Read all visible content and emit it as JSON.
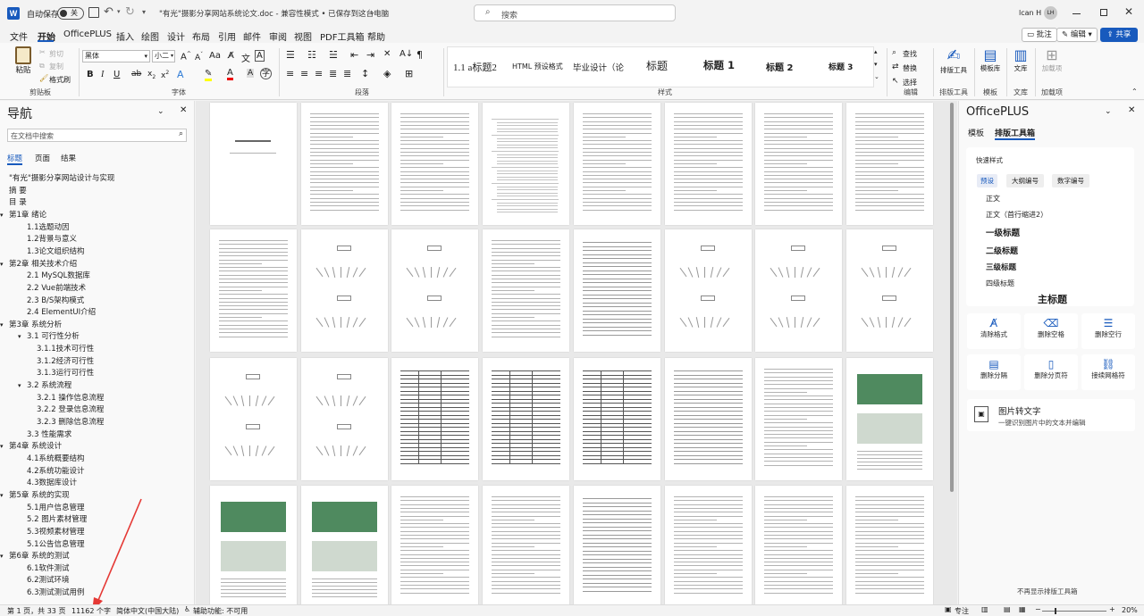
{
  "titlebar": {
    "autosave_label": "自动保存",
    "autosave_state": "关",
    "doc_title": "\"有光\"摄影分享网站系统论文.doc  -  兼容性模式  •  已保存到这台电脑",
    "search_placeholder": "搜索",
    "user_name": "lcan H",
    "user_initials": "LH"
  },
  "menubar": {
    "items": [
      "文件",
      "开始",
      "OfficePLUS",
      "插入",
      "绘图",
      "设计",
      "布局",
      "引用",
      "邮件",
      "审阅",
      "视图",
      "PDF工具箱",
      "帮助"
    ],
    "active": "开始",
    "comment_btn": "批注",
    "edit_btn": "编辑",
    "share_btn": "共享"
  },
  "ribbon": {
    "clipboard": {
      "paste": "粘贴",
      "cut": "剪切",
      "copy": "复制",
      "format_painter": "格式刷",
      "label": "剪贴板"
    },
    "font": {
      "name": "黑体",
      "size": "小二",
      "label": "字体"
    },
    "paragraph": {
      "label": "段落"
    },
    "styles": {
      "items": [
        "1.1 a标题2",
        "HTML 预设格式",
        "毕业设计（论",
        "标题",
        "标题 1",
        "标题 2",
        "标题 3"
      ],
      "label": "样式"
    },
    "editing": {
      "find": "查找",
      "replace": "替换",
      "select": "选择",
      "label": "编辑"
    },
    "layout_tool": {
      "btn": "排版工具",
      "label": "排版工具"
    },
    "template": {
      "btn": "模板库",
      "label": "模板"
    },
    "library": {
      "btn": "文库",
      "label": "文库"
    },
    "addins": {
      "btn": "加载项",
      "label": "加载项"
    }
  },
  "navpane": {
    "title": "导航",
    "search_placeholder": "在文档中搜索",
    "tabs": [
      "标题",
      "页面",
      "结果"
    ],
    "items": [
      {
        "text": "\"有光\"摄影分享网站设计与实现",
        "level": 0,
        "toggle": ""
      },
      {
        "text": "摘  要",
        "level": 0,
        "toggle": ""
      },
      {
        "text": "目  录",
        "level": 0,
        "toggle": ""
      },
      {
        "text": "第1章 绪论",
        "level": 0,
        "toggle": "▾"
      },
      {
        "text": "1.1选题动因",
        "level": 1,
        "toggle": ""
      },
      {
        "text": "1.2背景与意义",
        "level": 1,
        "toggle": ""
      },
      {
        "text": "1.3论文组织结构",
        "level": 1,
        "toggle": ""
      },
      {
        "text": "第2章 相关技术介绍",
        "level": 0,
        "toggle": "▾"
      },
      {
        "text": "2.1 MySQL数据库",
        "level": 1,
        "toggle": ""
      },
      {
        "text": "2.2 Vue前端技术",
        "level": 1,
        "toggle": ""
      },
      {
        "text": "2.3 B/S架构模式",
        "level": 1,
        "toggle": ""
      },
      {
        "text": "2.4 ElementUI介绍",
        "level": 1,
        "toggle": ""
      },
      {
        "text": "第3章 系统分析",
        "level": 0,
        "toggle": "▾"
      },
      {
        "text": "3.1 可行性分析",
        "level": 1,
        "toggle": "▾"
      },
      {
        "text": "3.1.1技术可行性",
        "level": 2,
        "toggle": ""
      },
      {
        "text": "3.1.2经济可行性",
        "level": 2,
        "toggle": ""
      },
      {
        "text": "3.1.3运行可行性",
        "level": 2,
        "toggle": ""
      },
      {
        "text": "3.2 系统流程",
        "level": 1,
        "toggle": "▾"
      },
      {
        "text": "3.2.1 操作信息流程",
        "level": 2,
        "toggle": ""
      },
      {
        "text": "3.2.2 登录信息流程",
        "level": 2,
        "toggle": ""
      },
      {
        "text": "3.2.3 删除信息流程",
        "level": 2,
        "toggle": ""
      },
      {
        "text": "3.3 性能需求",
        "level": 1,
        "toggle": ""
      },
      {
        "text": "第4章 系统设计",
        "level": 0,
        "toggle": "▾"
      },
      {
        "text": "4.1系统概要结构",
        "level": 1,
        "toggle": ""
      },
      {
        "text": "4.2系统功能设计",
        "level": 1,
        "toggle": ""
      },
      {
        "text": "4.3数据库设计",
        "level": 1,
        "toggle": ""
      },
      {
        "text": "第5章 系统的实现",
        "level": 0,
        "toggle": "▾"
      },
      {
        "text": "5.1用户信息管理",
        "level": 1,
        "toggle": ""
      },
      {
        "text": "5.2 图片素材管理",
        "level": 1,
        "toggle": ""
      },
      {
        "text": "5.3视频素材管理",
        "level": 1,
        "toggle": ""
      },
      {
        "text": "5.1公告信息管理",
        "level": 1,
        "toggle": ""
      },
      {
        "text": "第6章 系统的测试",
        "level": 0,
        "toggle": "▾"
      },
      {
        "text": "6.1软件测试",
        "level": 1,
        "toggle": ""
      },
      {
        "text": "6.2测试环境",
        "level": 1,
        "toggle": ""
      },
      {
        "text": "6.3测试测试用例",
        "level": 1,
        "toggle": ""
      }
    ]
  },
  "rightpane": {
    "title": "OfficePLUS",
    "tabs": [
      "模板",
      "排版工具箱"
    ],
    "quick_styles": {
      "heading": "快速样式",
      "chips": [
        "预设",
        "大纲编号",
        "数字编号"
      ],
      "styles": [
        "正文",
        "正文（首行缩进2）",
        "一级标题",
        "二级标题",
        "三级标题",
        "四级标题",
        "主标题"
      ]
    },
    "tools": [
      "清除格式",
      "删除空格",
      "删除空行",
      "删除分隔",
      "删除分页符",
      "接续网格符"
    ],
    "image_to_text": {
      "title": "图片转文字",
      "desc": "一键识别图片中的文本并编辑"
    },
    "footer": "不再显示排版工具箱"
  },
  "statusbar": {
    "page": "第 1 页，共 33 页",
    "words": "11162 个字",
    "language": "简体中文(中国大陆)",
    "accessibility": "辅助功能: 不可用",
    "focus": "专注",
    "zoom": "20%"
  }
}
